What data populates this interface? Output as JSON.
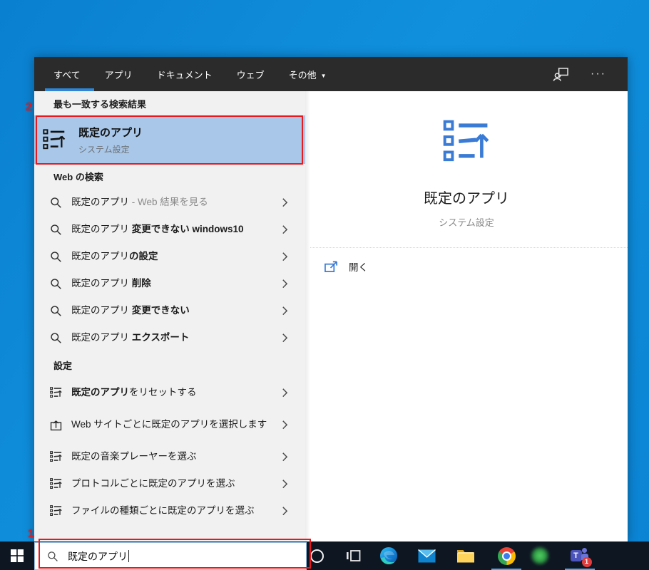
{
  "tabs": {
    "items": [
      {
        "label": "すべて",
        "selected": true
      },
      {
        "label": "アプリ",
        "selected": false
      },
      {
        "label": "ドキュメント",
        "selected": false
      },
      {
        "label": "ウェブ",
        "selected": false
      },
      {
        "label": "その他",
        "selected": false,
        "dropdown": "▼"
      }
    ]
  },
  "header": {
    "ellipsis": "···"
  },
  "left": {
    "best_header": "最も一致する検索結果",
    "best": {
      "title": "既定のアプリ",
      "subtitle": "システム設定"
    },
    "web_header": "Web の検索",
    "suggestions": [
      {
        "main": "既定のアプリ",
        "extra": " - Web 結果を見る"
      },
      {
        "main": "既定のアプリ ",
        "extra": "変更できない windows10"
      },
      {
        "main": "既定のアプリ",
        "extra": "の設定"
      },
      {
        "main": "既定のアプリ ",
        "extra": "削除"
      },
      {
        "main": "既定のアプリ ",
        "extra": "変更できない"
      },
      {
        "main": "既定のアプリ ",
        "extra": "エクスポート"
      }
    ],
    "settings_header": "設定",
    "settings": [
      {
        "bold": "既定のアプリ",
        "rest": "をリセットする",
        "icon": "default-apps"
      },
      {
        "bold": "",
        "rest": "Web サイトごとに既定のアプリを選択します",
        "icon": "open-website"
      },
      {
        "bold": "",
        "rest": "既定の音楽プレーヤーを選ぶ",
        "icon": "default-apps"
      },
      {
        "bold": "",
        "rest": "プロトコルごとに既定のアプリを選ぶ",
        "icon": "default-apps"
      },
      {
        "bold": "",
        "rest": "ファイルの種類ごとに既定のアプリを選ぶ",
        "icon": "default-apps"
      }
    ]
  },
  "right": {
    "title": "既定のアプリ",
    "subtitle": "システム設定",
    "open_label": "開く"
  },
  "search": {
    "value": "既定のアプリ"
  },
  "taskbar": {
    "icons": [
      "start",
      "cortana",
      "task-view",
      "edge",
      "mail",
      "file-explorer",
      "chrome",
      "green-app",
      "teams"
    ],
    "teams_badge": "1",
    "running_indicators": [
      "chrome",
      "teams"
    ]
  },
  "annotations": {
    "label1": "1",
    "label2": "2",
    "box_color": "#e8181d"
  },
  "colors": {
    "accent_blue": "#3a7bd5",
    "highlight_bg": "#a9c7e8",
    "header_bg": "#2b2b2b",
    "desktop_blue": "#0d86d6",
    "taskbar_bg": "#0e1622",
    "tab_underline": "#2f86d6"
  }
}
